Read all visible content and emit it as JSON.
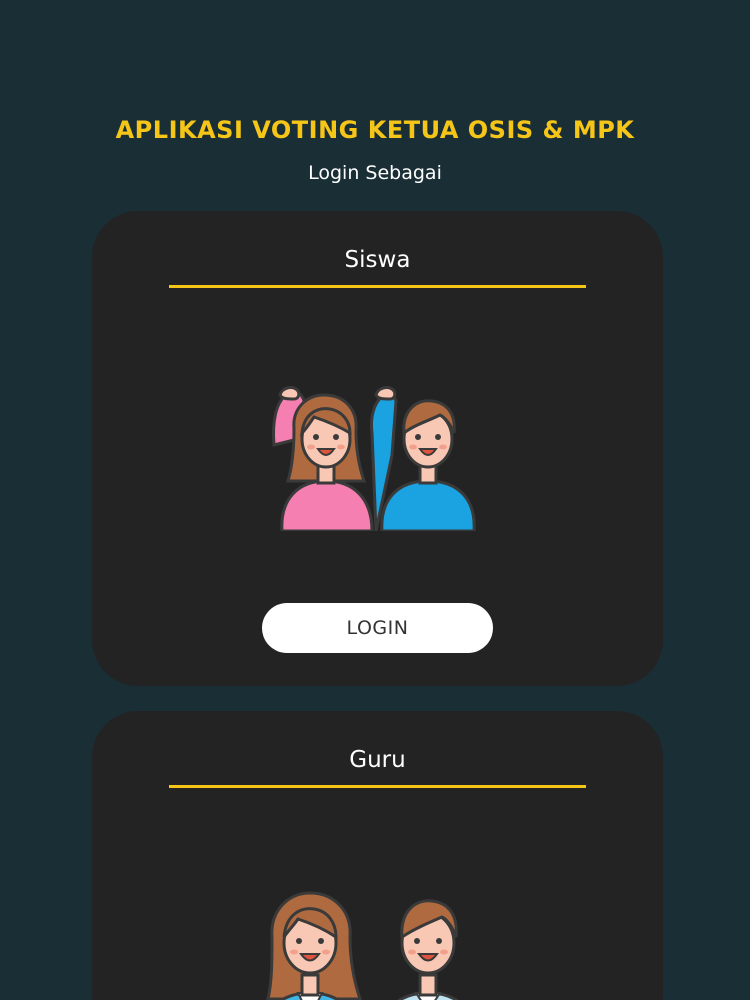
{
  "header": {
    "title": "APLIKASI VOTING KETUA OSIS & MPK",
    "subtitle": "Login Sebagai"
  },
  "cards": [
    {
      "title": "Siswa",
      "icon": "students-raising-hands-icon",
      "button_label": "LOGIN"
    },
    {
      "title": "Guru",
      "icon": "teachers-icon"
    }
  ],
  "colors": {
    "background": "#1a2e36",
    "card": "#232323",
    "accent": "#f5c518",
    "button": "#ffffff"
  }
}
